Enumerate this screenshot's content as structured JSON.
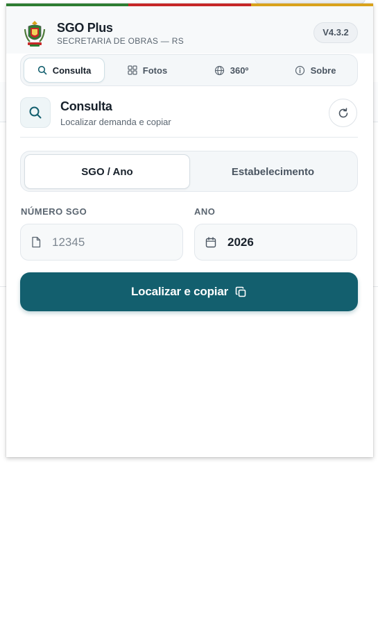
{
  "header": {
    "title": "SGO Plus",
    "subtitle": "SECRETARIA DE OBRAS — RS",
    "version": "V4.3.2"
  },
  "tabs": [
    {
      "label": "Consulta",
      "icon": "search-icon",
      "active": true
    },
    {
      "label": "Fotos",
      "icon": "grid-icon",
      "active": false
    },
    {
      "label": "360º",
      "icon": "globe-icon",
      "active": false
    },
    {
      "label": "Sobre",
      "icon": "info-icon",
      "active": false
    }
  ],
  "section": {
    "title": "Consulta",
    "subtitle": "Localizar demanda e copiar"
  },
  "mode": {
    "options": [
      "SGO / Ano",
      "Estabelecimento"
    ],
    "selected": "SGO / Ano"
  },
  "form": {
    "sgo_label": "NÚMERO SGO",
    "sgo_placeholder": "12345",
    "sgo_value": "",
    "year_label": "ANO",
    "year_value": "2026"
  },
  "action": {
    "label": "Localizar e copiar"
  },
  "colors": {
    "accent": "#135f6e",
    "flag_green": "#2e7d32",
    "flag_red": "#c62828",
    "flag_yellow": "#d9a21b"
  }
}
